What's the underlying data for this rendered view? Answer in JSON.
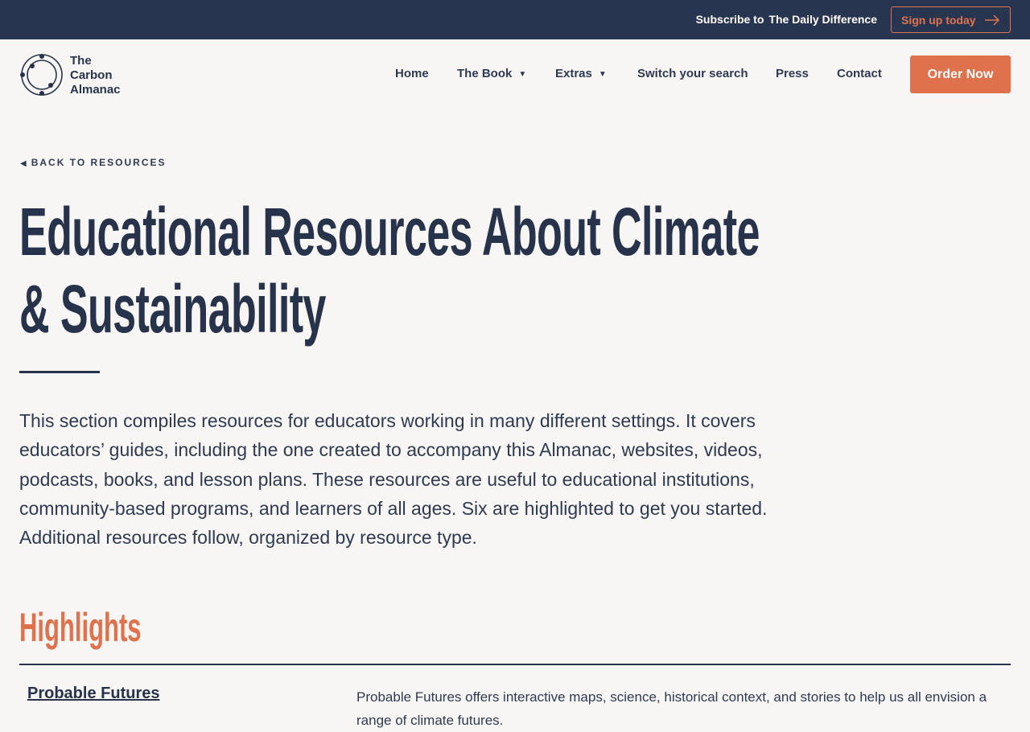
{
  "topbar": {
    "subscribe_prefix": "Subscribe to",
    "subscribe_name": "The Daily Difference",
    "signup_label": "Sign up today",
    "signup_icon": "arrow-right-icon"
  },
  "logo": {
    "line1": "The",
    "line2": "Carbon",
    "line3": "Almanac"
  },
  "nav": {
    "home": "Home",
    "book": "The Book",
    "extras": "Extras",
    "switch": "Switch your search",
    "press": "Press",
    "contact": "Contact",
    "order": "Order Now",
    "caret_icon": "caret-down-icon"
  },
  "back_link": "BACK TO RESOURCES",
  "title_line1": "Educational Resources About Climate",
  "title_line2": "& Sustainability",
  "intro": "This section compiles resources for educators working in many different settings. It covers educators’ guides, including the one created to accompany this Almanac, websites, videos, podcasts, books, and lesson plans. These resources are useful to educational institutions, community-based programs, and learners of all ages. Six are highlighted to get you started. Additional resources follow, organized by resource type.",
  "highlights": {
    "heading": "Highlights",
    "items": [
      {
        "name": "Probable Futures",
        "description": "Probable Futures offers interactive maps, science, historical context, and stories to help us all envision a range of climate futures."
      }
    ]
  },
  "colors": {
    "navy": "#283550",
    "accent": "#df714c",
    "background": "#f7f6f4"
  }
}
